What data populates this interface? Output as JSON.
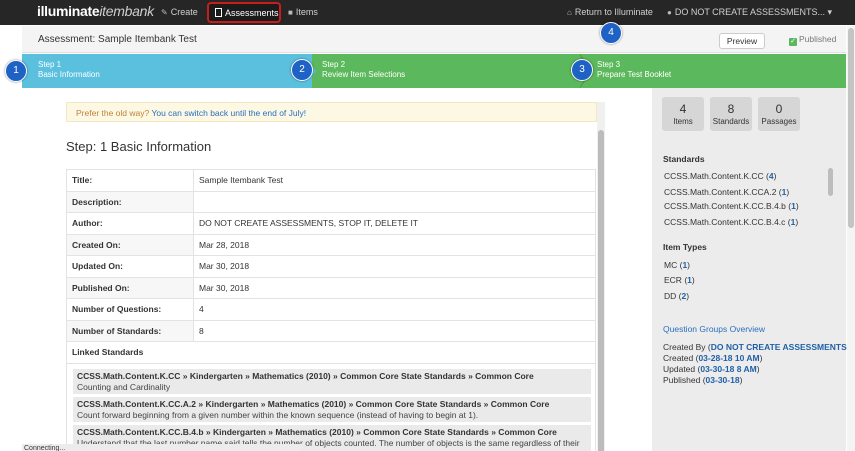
{
  "nav": {
    "logo_bold": "illuminate",
    "logo_thin": "itembank",
    "create": "Create",
    "assessments": "Assessments",
    "items": "Items",
    "return": "Return to Illuminate",
    "user": "DO NOT CREATE ASSESSMENTS... ▾"
  },
  "header": {
    "title": "Assessment: Sample Itembank Test",
    "preview_label": "Preview",
    "published_label": "Published"
  },
  "steps": [
    {
      "title": "Step 1",
      "subtitle": "Basic Information",
      "badge": "1"
    },
    {
      "title": "Step 2",
      "subtitle": "Review Item Selections",
      "badge": "2"
    },
    {
      "title": "Step 3",
      "subtitle": "Prepare Test Booklet",
      "badge": "3"
    }
  ],
  "extra_badge": "4",
  "notice": {
    "text": "Prefer the old way?",
    "link": "You can switch back until the end of July!"
  },
  "section_title": "Step: 1 Basic Information",
  "info": [
    {
      "k": "Title:",
      "v": "Sample Itembank Test"
    },
    {
      "k": "Description:",
      "v": ""
    },
    {
      "k": "Author:",
      "v": "DO NOT CREATE ASSESSMENTS, STOP IT, DELETE IT"
    },
    {
      "k": "Created On:",
      "v": "Mar 28, 2018"
    },
    {
      "k": "Updated On:",
      "v": "Mar 30, 2018"
    },
    {
      "k": "Published On:",
      "v": "Mar 30, 2018"
    },
    {
      "k": "Number of Questions:",
      "v": "4"
    },
    {
      "k": "Number of Standards:",
      "v": "8"
    },
    {
      "k": "Linked Standards",
      "v": ""
    }
  ],
  "linked_standards": [
    {
      "head": "CCSS.Math.Content.K.CC » Kindergarten » Mathematics (2010) » Common Core State Standards » Common Core",
      "desc": "Counting and Cardinality"
    },
    {
      "head": "CCSS.Math.Content.K.CC.A.2 » Kindergarten » Mathematics (2010) » Common Core State Standards » Common Core",
      "desc": "Count forward beginning from a given number within the known sequence (instead of having to begin at 1)."
    },
    {
      "head": "CCSS.Math.Content.K.CC.B.4.b » Kindergarten » Mathematics (2010) » Common Core State Standards » Common Core",
      "desc": "Understand that the last number name said tells the number of objects counted. The number of objects is the same regardless of their"
    }
  ],
  "stats": [
    {
      "n": "4",
      "l": "Items"
    },
    {
      "n": "8",
      "l": "Standards"
    },
    {
      "n": "0",
      "l": "Passages"
    }
  ],
  "sidebar": {
    "standards_title": "Standards",
    "standards": [
      {
        "name": "CCSS.Math.Content.K.CC",
        "count": "4"
      },
      {
        "name": "CCSS.Math.Content.K.CCA.2",
        "count": "1"
      },
      {
        "name": "CCSS.Math.Content.K.CC.B.4.b",
        "count": "1"
      },
      {
        "name": "CCSS.Math.Content.K.CC.B.4.c",
        "count": "1"
      }
    ],
    "item_types_title": "Item Types",
    "item_types": [
      {
        "name": "MC",
        "count": "1"
      },
      {
        "name": "ECR",
        "count": "1"
      },
      {
        "name": "DD",
        "count": "2"
      }
    ],
    "qgroups_link": "Question Groups Overview",
    "created_by_label": "Created By",
    "created_by_value": "DO NOT CREATE ASSESSMENTS,",
    "created_label": "Created",
    "created_value": "03-28-18 10 AM",
    "updated_label": "Updated",
    "updated_value": "03-30-18 8 AM",
    "published_label": "Published",
    "published_value": "03-30-18"
  },
  "status": "Connecting..."
}
